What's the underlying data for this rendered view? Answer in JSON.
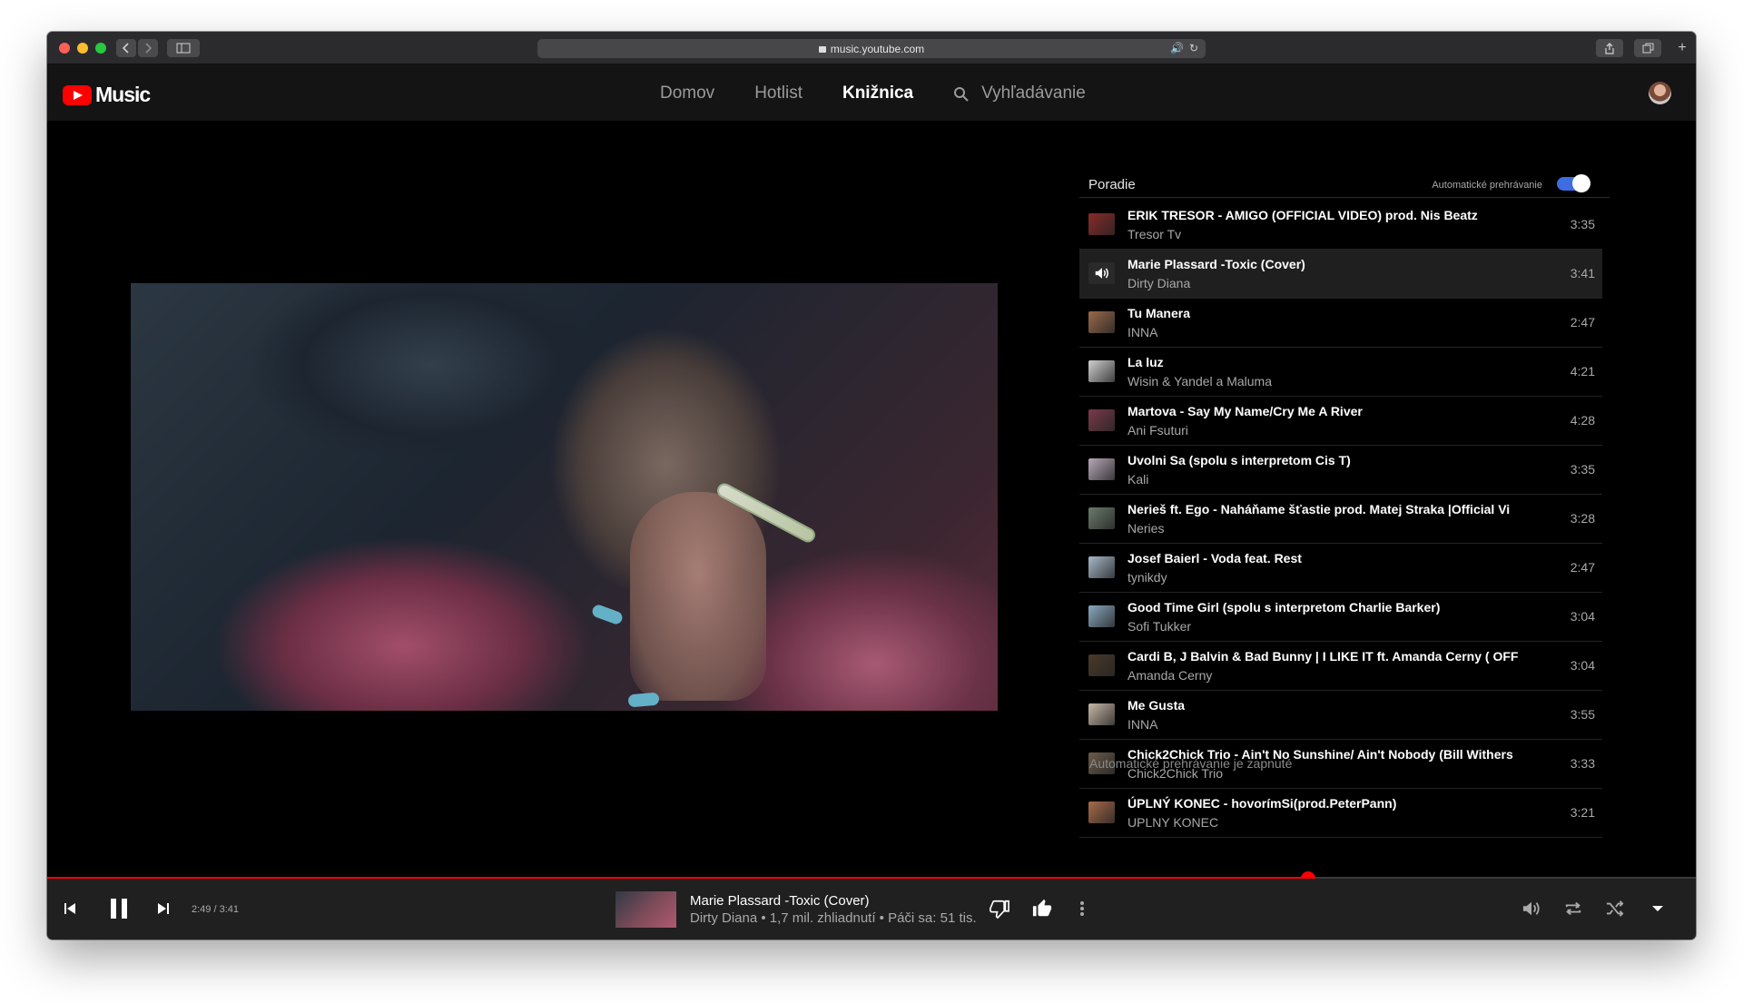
{
  "browser": {
    "url": "music.youtube.com"
  },
  "header": {
    "logo_text": "Music",
    "nav": [
      {
        "label": "Domov",
        "active": false
      },
      {
        "label": "Hotlist",
        "active": false
      },
      {
        "label": "Knižnica",
        "active": true
      }
    ],
    "search_label": "Vyhľadávanie"
  },
  "queue": {
    "title": "Poradie",
    "autoplay_label": "Automatické prehrávanie",
    "autoplay_on": true,
    "footer_text": "Automatické prehrávanie je zapnuté",
    "items": [
      {
        "title": "ERIK TRESOR - AMIGO (OFFICIAL VIDEO) prod. Nis Beatz",
        "artist": "Tresor Tv",
        "duration": "3:35",
        "thumb": "#8a2a2a"
      },
      {
        "title": "Marie Plassard -Toxic (Cover)",
        "artist": "Dirty Diana",
        "duration": "3:41",
        "thumb": "#2a2a2a",
        "playing": true
      },
      {
        "title": "Tu Manera",
        "artist": "INNA",
        "duration": "2:47",
        "thumb": "#9a6a4a"
      },
      {
        "title": "La luz",
        "artist": "Wisin & Yandel a Maluma",
        "duration": "4:21",
        "thumb": "#d0d0d0"
      },
      {
        "title": "Martova - Say My Name/Cry Me A River",
        "artist": "Ani Fsuturi",
        "duration": "4:28",
        "thumb": "#7a3a4a"
      },
      {
        "title": "Uvolni Sa (spolu s interpretom Cis T)",
        "artist": "Kali",
        "duration": "3:35",
        "thumb": "#b8a8b8"
      },
      {
        "title": "Nerieš ft. Ego - Naháňame šťastie prod. Matej Straka |Official Vi",
        "artist": "Neries",
        "duration": "3:28",
        "thumb": "#6a7a6a"
      },
      {
        "title": "Josef Baierl - Voda feat. Rest",
        "artist": "tynikdy",
        "duration": "2:47",
        "thumb": "#a8b8c8"
      },
      {
        "title": "Good Time Girl (spolu s interpretom Charlie Barker)",
        "artist": "Sofi Tukker",
        "duration": "3:04",
        "thumb": "#8aa8c0"
      },
      {
        "title": "Cardi B, J Balvin & Bad Bunny | I LIKE IT ft. Amanda Cerny ( OFF",
        "artist": "Amanda Cerny",
        "duration": "3:04",
        "thumb": "#4a3a2a"
      },
      {
        "title": "Me Gusta",
        "artist": "INNA",
        "duration": "3:55",
        "thumb": "#c8b8a8"
      },
      {
        "title": "Chick2Chick Trio - Ain't No Sunshine/ Ain't Nobody (Bill Withers",
        "artist": "Chick2Chick Trio",
        "duration": "3:33",
        "thumb": "#6a5a4a"
      },
      {
        "title": "ÚPLNÝ KONEC - hovorímSi(prod.PeterPann)",
        "artist": "UPLNY KONEC",
        "duration": "3:21",
        "thumb": "#a86a4a"
      }
    ]
  },
  "player": {
    "time": "2:49 / 3:41",
    "progress_fraction": 0.7647,
    "title": "Marie Plassard -Toxic (Cover)",
    "subtitle": "Dirty Diana • 1,7 mil. zhliadnutí • Páči sa: 51 tis.",
    "accent": "#ff0000"
  },
  "icons": {
    "queue_playing": "volume-icon",
    "controls": [
      "skip-previous-icon",
      "pause-icon",
      "skip-next-icon",
      "thumb-down-icon",
      "thumb-up-icon",
      "more-vert-icon",
      "volume-icon",
      "repeat-icon",
      "shuffle-icon",
      "chevron-down-icon"
    ]
  }
}
